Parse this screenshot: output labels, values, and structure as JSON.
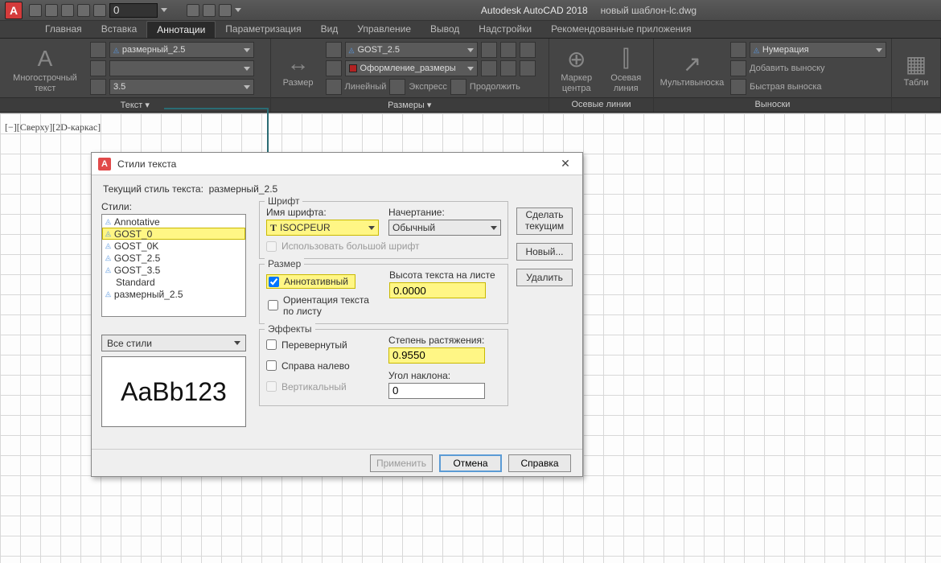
{
  "titlebar": {
    "app": "Autodesk AutoCAD 2018",
    "file": "новый шаблон-lc.dwg",
    "qat_value": "0"
  },
  "tabs": [
    "Главная",
    "Вставка",
    "Аннотации",
    "Параметризация",
    "Вид",
    "Управление",
    "Вывод",
    "Надстройки",
    "Рекомендованные приложения"
  ],
  "active_tab_index": 2,
  "ribbon": {
    "text_panel": {
      "big_label": "Многострочный текст",
      "style_dd": "размерный_2.5",
      "height_dd": "3.5",
      "group_label": "Текст ▾"
    },
    "dims_panel": {
      "big_label": "Размер",
      "style_dd": "GOST_2.5",
      "layer_dd": "Оформление_размеры",
      "btns": [
        "Линейный",
        "Экспресс",
        "Продолжить"
      ],
      "group_label": "Размеры ▾"
    },
    "center_panel": {
      "btn1": "Маркер центра",
      "btn2": "Осевая линия",
      "group_label": "Осевые линии"
    },
    "leader_panel": {
      "big_label": "Мультивыноска",
      "style_dd": "Нумерация",
      "btn_add": "Добавить выноску",
      "btn_sub": "Быстрая выноска",
      "group_label": "Выноски"
    },
    "tables_panel": {
      "big_label": "Табли"
    }
  },
  "workspace": {
    "viewlabel": "[−][Сверху][2D-каркас]"
  },
  "dialog": {
    "title": "Стили текста",
    "current_label": "Текущий стиль текста:",
    "current_value": "размерный_2.5",
    "styles_label": "Стили:",
    "styles": [
      "Annotative",
      "GOST_0",
      "GOST_0K",
      "GOST_2.5",
      "GOST_3.5",
      "Standard",
      "размерный_2.5"
    ],
    "selected_style_index": 1,
    "filter": "Все стили",
    "preview": "AaBb123",
    "font_group": {
      "label": "Шрифт",
      "name_label": "Имя шрифта:",
      "font_name": "ISOCPEUR",
      "face_label": "Начертание:",
      "face_value": "Обычный",
      "bigfont_chk": "Использовать большой шрифт"
    },
    "size_group": {
      "label": "Размер",
      "annotative_chk": "Аннотативный",
      "orient_chk": "Ориентация текста по листу",
      "height_label": "Высота текста на листе",
      "height_value": "0.0000"
    },
    "effects_group": {
      "label": "Эффекты",
      "flip_chk": "Перевернутый",
      "rtl_chk": "Справа налево",
      "vertical_chk": "Вертикальный",
      "width_label": "Степень растяжения:",
      "width_value": "0.9550",
      "oblique_label": "Угол наклона:",
      "oblique_value": "0"
    },
    "side_buttons": {
      "current": "Сделать текущим",
      "new": "Новый...",
      "delete": "Удалить"
    },
    "footer": {
      "apply": "Применить",
      "cancel": "Отмена",
      "help": "Справка"
    }
  }
}
